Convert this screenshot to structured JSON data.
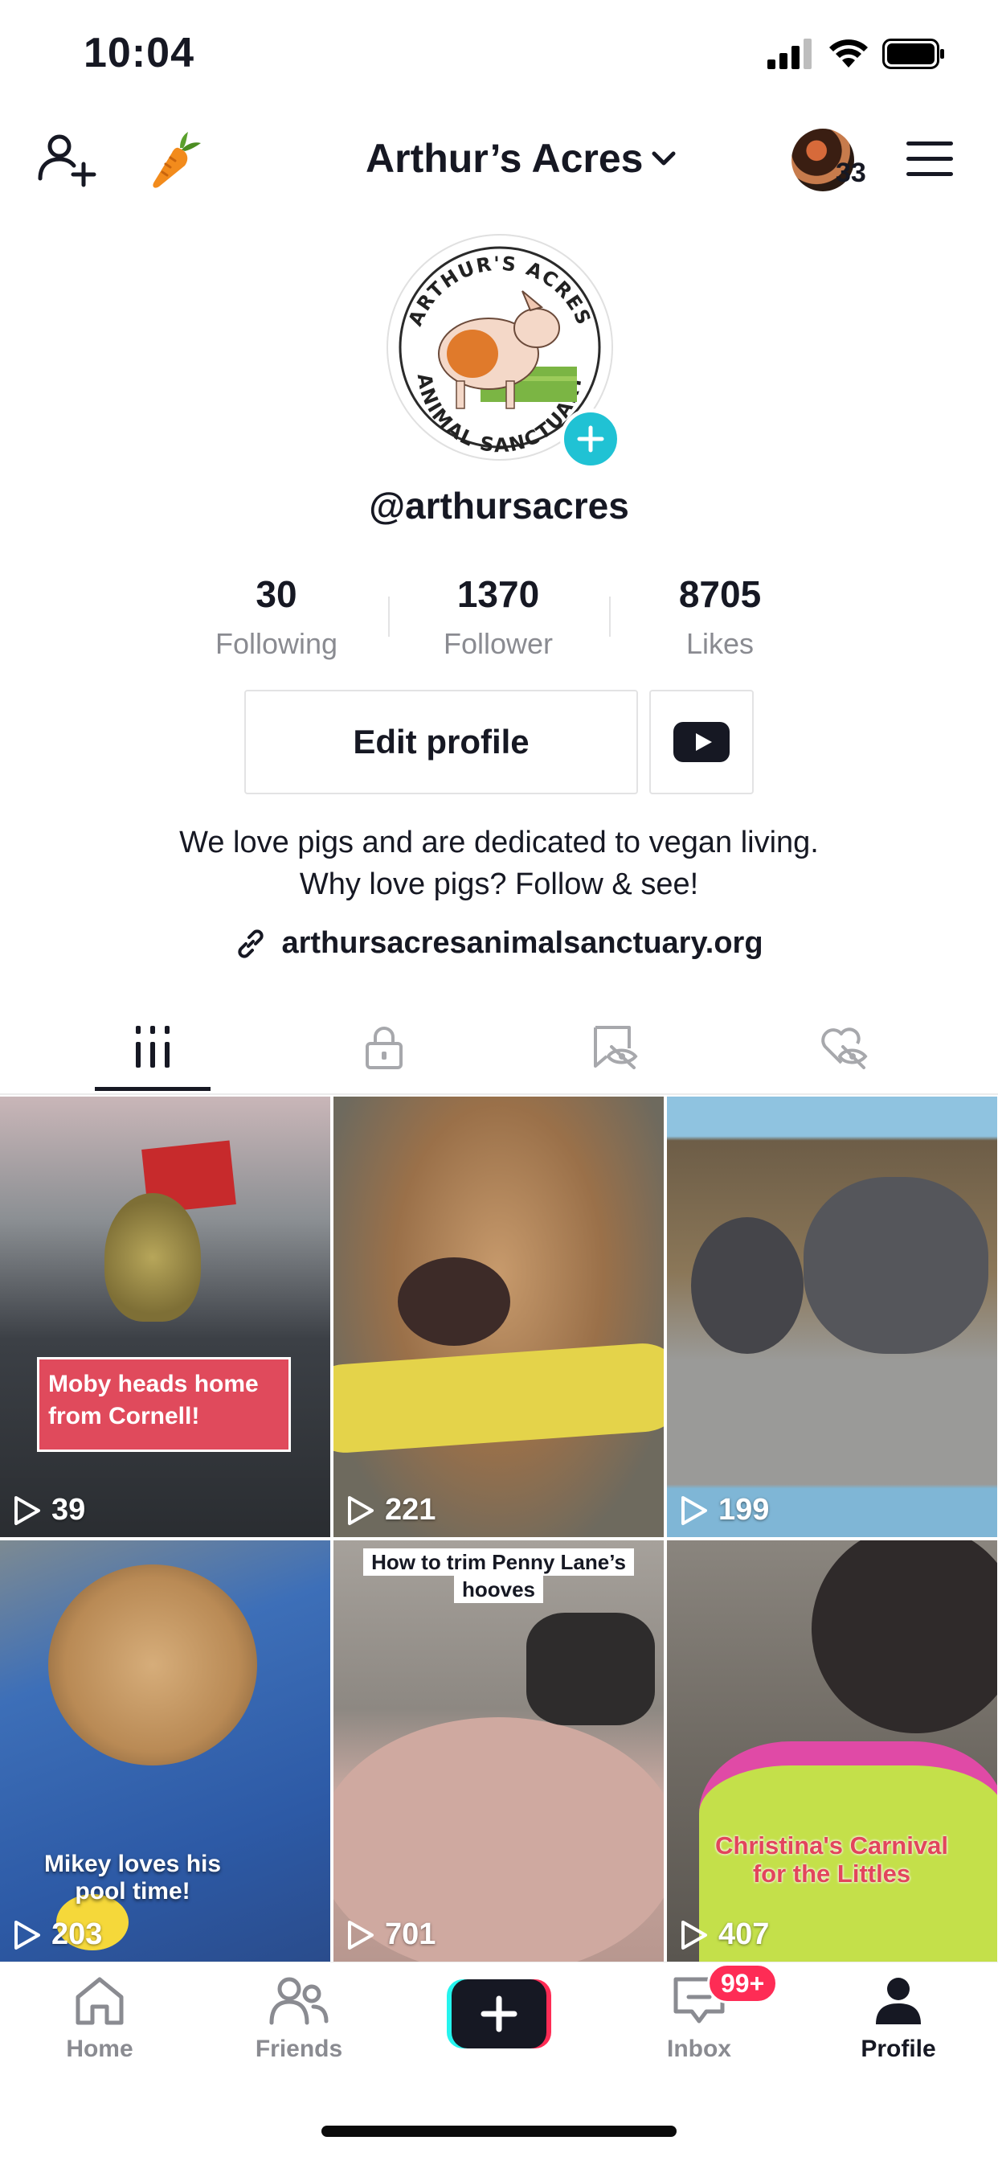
{
  "status_bar": {
    "time": "10:04"
  },
  "header": {
    "title": "Arthur’s Acres",
    "avatar_count": "33"
  },
  "profile": {
    "logo_text_top": "ARTHUR'S ACRES",
    "logo_text_bottom": "ANIMAL SANCTUARY",
    "handle": "@arthursacres",
    "stats": [
      {
        "value": "30",
        "label": "Following"
      },
      {
        "value": "1370",
        "label": "Follower"
      },
      {
        "value": "8705",
        "label": "Likes"
      }
    ],
    "edit_label": "Edit profile",
    "bio_line1": "We love pigs and are dedicated to vegan living.",
    "bio_line2": "Why love pigs? Follow & see!",
    "link": "arthursacresanimalsanctuary.org"
  },
  "tabs": [
    "videos-grid-icon",
    "lock-icon",
    "hidden-bookmark-icon",
    "hidden-heart-icon"
  ],
  "videos": [
    {
      "views": "39",
      "caption": "Moby heads home from Cornell!"
    },
    {
      "views": "221",
      "caption": ""
    },
    {
      "views": "199",
      "caption": ""
    },
    {
      "views": "203",
      "caption": "Mikey loves his pool time!"
    },
    {
      "views": "701",
      "caption": "How to trim Penny Lane’s hooves"
    },
    {
      "views": "407",
      "caption": "Christina's Carnival for the Littles"
    }
  ],
  "nav": {
    "home": "Home",
    "friends": "Friends",
    "inbox": "Inbox",
    "inbox_badge": "99+",
    "profile": "Profile"
  },
  "colors": {
    "accent_teal": "#20c2d4",
    "accent_red": "#fe2c55",
    "text": "#161823",
    "muted": "#8a8b91"
  }
}
